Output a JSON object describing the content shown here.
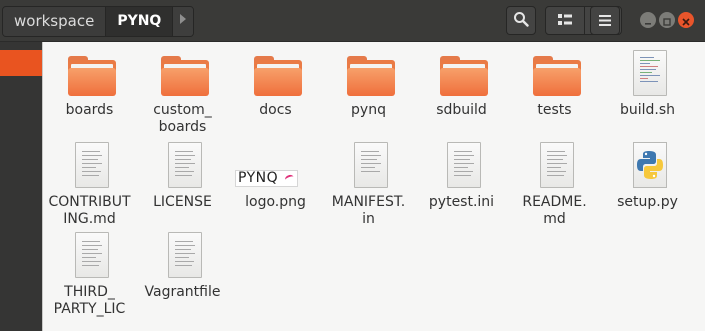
{
  "header": {
    "breadcrumbs": [
      {
        "label": "workspace",
        "active": false
      },
      {
        "label": "PYNQ",
        "active": true
      }
    ],
    "nav_next_icon": "chevron-right-icon",
    "search_icon": "search-icon",
    "view_icons": [
      "grid-view-icon",
      "sort-chevron-icon"
    ],
    "menu_icon": "hamburger-menu-icon",
    "window_controls": [
      "minimize-icon",
      "maximize-icon",
      "close-icon"
    ]
  },
  "colors": {
    "accent": "#e95420",
    "header_bg": "#3a3a38",
    "sidebar_bg": "#353534",
    "content_bg": "#f6f6f5",
    "folder_orange": "#ef6f3c"
  },
  "files": [
    {
      "name": "boards",
      "type": "folder",
      "icon": "folder-icon"
    },
    {
      "name": "custom_\nboards",
      "type": "folder",
      "icon": "folder-icon"
    },
    {
      "name": "docs",
      "type": "folder",
      "icon": "folder-icon"
    },
    {
      "name": "pynq",
      "type": "folder",
      "icon": "folder-icon"
    },
    {
      "name": "sdbuild",
      "type": "folder",
      "icon": "folder-icon"
    },
    {
      "name": "tests",
      "type": "folder",
      "icon": "folder-icon"
    },
    {
      "name": "build.sh",
      "type": "script",
      "icon": "shell-script-icon"
    },
    {
      "name": "CONTRIBUT\nING.md",
      "type": "text",
      "icon": "text-file-icon"
    },
    {
      "name": "LICENSE",
      "type": "text",
      "icon": "text-file-icon"
    },
    {
      "name": "logo.png",
      "type": "image",
      "icon": "image-thumbnail-icon",
      "thumbnail_text": "PYNQ"
    },
    {
      "name": "MANIFEST.\nin",
      "type": "text",
      "icon": "text-file-icon"
    },
    {
      "name": "pytest.ini",
      "type": "text",
      "icon": "text-file-icon"
    },
    {
      "name": "README.\nmd",
      "type": "text",
      "icon": "text-file-icon"
    },
    {
      "name": "setup.py",
      "type": "python",
      "icon": "python-file-icon"
    },
    {
      "name": "THIRD_\nPARTY_LIC",
      "type": "text",
      "icon": "text-file-icon"
    },
    {
      "name": "Vagrantfile",
      "type": "text",
      "icon": "text-file-icon"
    }
  ]
}
